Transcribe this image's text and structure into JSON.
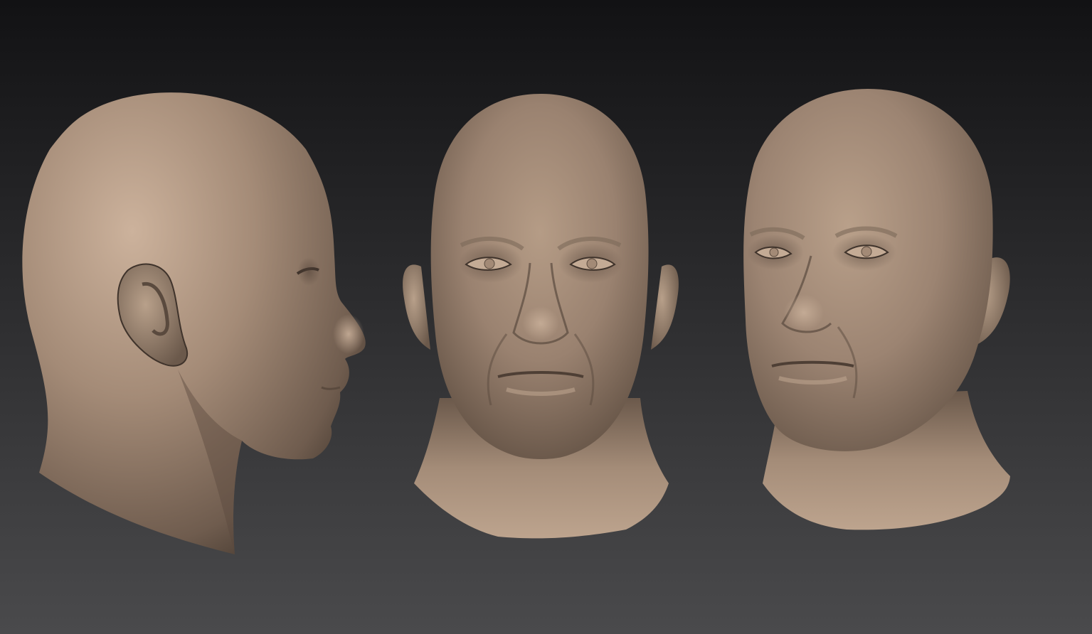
{
  "scene": {
    "background_top": "#121214",
    "background_bottom": "#4a4a4c",
    "skin_highlight": "#c8ad97",
    "skin_mid": "#9a8270",
    "skin_shadow": "#4e3f35",
    "views": [
      {
        "id": "side",
        "facing": "right"
      },
      {
        "id": "front",
        "facing": "viewer"
      },
      {
        "id": "three-quarter",
        "facing": "left"
      }
    ]
  }
}
